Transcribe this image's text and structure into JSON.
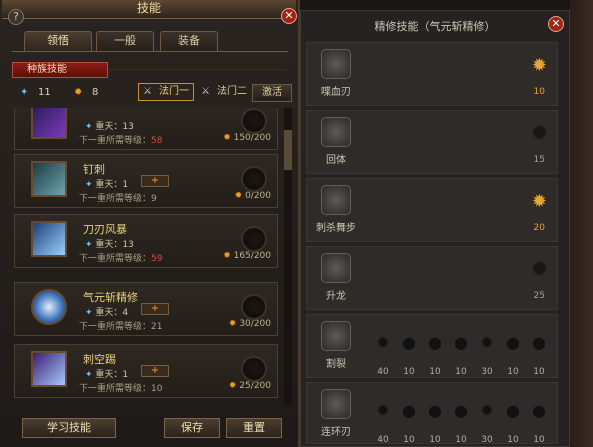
{
  "window": {
    "title": "技能"
  },
  "tabs": [
    {
      "label": "领悟",
      "active": true
    },
    {
      "label": "一般",
      "active": false
    },
    {
      "label": "装备",
      "active": false
    }
  ],
  "race_header": "种族技能",
  "counts": {
    "blue": "11",
    "orange": "8"
  },
  "faction_buttons": [
    {
      "label": "法门一",
      "selected": true
    },
    {
      "label": "法门二",
      "selected": false
    }
  ],
  "activate_label": "激活",
  "skills": [
    {
      "name": "",
      "level": "重天：13",
      "req_label": "下一重所需等级：",
      "req_value": "58",
      "progress": "150/200",
      "has_plus": false
    },
    {
      "name": "钉刺",
      "level": "重天：1",
      "req_label": "下一重所需等级：",
      "req_value": "9",
      "progress": "0/200",
      "has_plus": true
    },
    {
      "name": "刀刃风暴",
      "level": "重天：13",
      "req_label": "下一重所需等级：",
      "req_value": "59",
      "progress": "165/200",
      "has_plus": false
    },
    {
      "name": "气元斩精修",
      "level": "重天：4",
      "req_label": "下一重所需等级：",
      "req_value": "21",
      "progress": "30/200",
      "has_plus": true
    },
    {
      "name": "刺空踢",
      "level": "重天：1",
      "req_label": "下一重所需等级：",
      "req_value": "10",
      "progress": "25/200",
      "has_plus": true
    }
  ],
  "bottom_buttons": {
    "learn": "学习技能",
    "save": "保存",
    "reset": "重置"
  },
  "refine": {
    "title": "精修技能（气元斩精修）",
    "rows": [
      {
        "name": "喋血刃",
        "value": "10",
        "lit": true
      },
      {
        "name": "回体",
        "value": "15",
        "lit": false
      },
      {
        "name": "刺杀舞步",
        "value": "20",
        "lit": true
      },
      {
        "name": "升龙",
        "value": "25",
        "lit": false
      },
      {
        "name": "割裂",
        "subvalues": [
          "40",
          "10",
          "10",
          "10",
          "30",
          "10",
          "10"
        ]
      },
      {
        "name": "连环刃",
        "subvalues": [
          "40",
          "10",
          "10",
          "10",
          "30",
          "10",
          "10"
        ]
      }
    ]
  },
  "colors": {
    "accent_gold": "#e6a630",
    "header_red": "#8c1d16",
    "req_red": "#d84a38"
  }
}
